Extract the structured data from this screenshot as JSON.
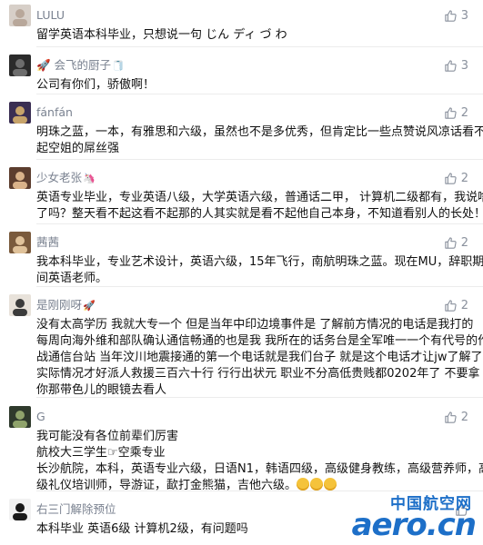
{
  "comments": [
    {
      "id": "c1",
      "name": "LULU",
      "name_deco": "",
      "likes": "3",
      "lines": [
        "留学英语本科毕业，只想说一句 じん ディ づ わ"
      ],
      "avatar_colors": [
        "#d7cfc8",
        "#b8a79a"
      ]
    },
    {
      "id": "c2",
      "name": "🚀 会飞的厨子",
      "name_deco": "🧻",
      "likes": "3",
      "lines": [
        "公司有你们，骄傲啊！"
      ],
      "avatar_colors": [
        "#2b2b2b",
        "#6d6d6d"
      ]
    },
    {
      "id": "c3",
      "name": "fánfán",
      "name_deco": "",
      "likes": "2",
      "lines": [
        "明珠之蓝，一本，有雅思和六级，虽然也不是多优秀，但肯定比一些点赞说风凉话看不",
        "起空姐的屌丝强"
      ],
      "avatar_colors": [
        "#3a2e52",
        "#c7a36a"
      ]
    },
    {
      "id": "c4",
      "name": "少女老张",
      "name_deco": "🦄",
      "likes": "2",
      "lines": [
        "英语专业毕业，专业英语八级，大学英语六级，普通话二甲， 计算机二级都有，我说啥",
        "了吗？整天看不起这看不起那的人其实就是看不起他自己本身，不知道看别人的长处！"
      ],
      "avatar_colors": [
        "#5c3d2e",
        "#d9b28a"
      ]
    },
    {
      "id": "c5",
      "name": "茜茜",
      "name_deco": "",
      "likes": "2",
      "lines": [
        "我本科毕业，专业艺术设计，英语六级，15年飞行，南航明珠之蓝。现在MU，辞职期",
        "间英语老师。"
      ],
      "avatar_colors": [
        "#7a5a3c",
        "#e0c29a"
      ]
    },
    {
      "id": "c6",
      "name": "是刚刚呀",
      "name_deco": "🚀",
      "likes": "2",
      "lines": [
        "没有太高学历 我就大专一个 但是当年中印边境事件是 了解前方情况的电话是我打的",
        "每周向海外维和部队确认通信畅通的也是我 我所在的话务台是全军唯一一个有代号的作",
        "战通信台站 当年汶川地震接通的第一个电话就是我们台子 就是这个电话才让jw了解了",
        "实际情况才好派人救援三百六十行 行行出状元  职业不分高低贵贱都0202年了 不要拿",
        "你那带色儿的眼镜去看人"
      ],
      "avatar_colors": [
        "#e8e2da",
        "#3b3b3b"
      ]
    },
    {
      "id": "c7",
      "name": "G",
      "name_deco": "",
      "likes": "2",
      "lines": [
        "我可能没有各位前辈们厉害",
        "航校大三学生☞空乘专业",
        "长沙航院，本科，英语专业六级，日语N1，韩语四级，高级健身教练，高级营养师，高",
        "级礼仪培训师，导游证，歃打金熊猫，吉他六级。"
      ],
      "emoji_count": 3,
      "avatar_colors": [
        "#2f3a2c",
        "#8fa36b"
      ]
    },
    {
      "id": "c8",
      "name": "右三门解除预位",
      "name_deco": "",
      "likes": "",
      "lines": [
        "本科毕业 英语6级 计算机2级，有问题吗"
      ],
      "avatar_colors": [
        "#f2f2f2",
        "#1a1a1a"
      ]
    }
  ],
  "watermark": {
    "cn": "中国航空网",
    "en": "aero.cn",
    "color": "#1d6fc8"
  },
  "icons": {
    "like": "thumbs-up-icon"
  }
}
